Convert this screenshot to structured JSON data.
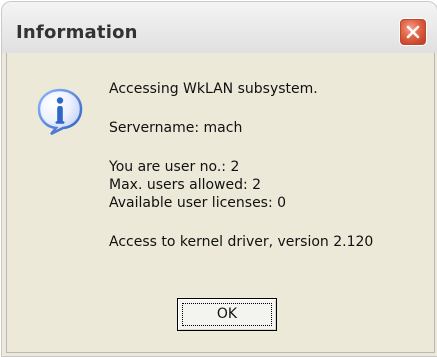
{
  "window": {
    "title": "Information",
    "close_icon": "close-icon"
  },
  "dialog": {
    "icon": "info-icon",
    "lines": {
      "line1": "Accessing WkLAN subsystem.",
      "line2": "Servername: mach",
      "line3": "You are user no.: 2",
      "line4": "Max. users allowed: 2",
      "line5": "Available user licenses: 0",
      "line6": "Access to kernel driver, version 2.120"
    },
    "buttons": {
      "ok": "OK"
    }
  },
  "colors": {
    "titlebar_text": "#333333",
    "dialog_bg": "#ece9d8",
    "close_red": "#d65a3e",
    "info_blue": "#2f67c8"
  }
}
